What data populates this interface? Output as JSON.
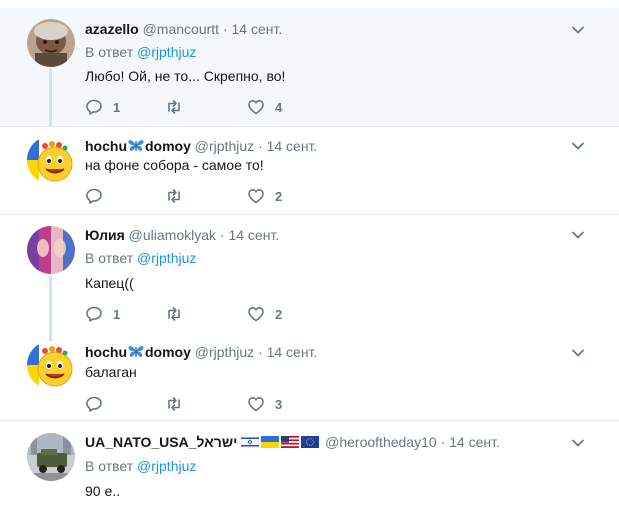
{
  "tweets": [
    {
      "name": "azazello",
      "handle": "@mancourtt",
      "dot": "·",
      "time": "14 сент.",
      "reply_prefix": "В ответ",
      "reply_to": "@rjpthjuz",
      "text": "Любо! Ой, не то... Скрепно, во!",
      "replies": "1",
      "retweets": "",
      "likes": "4"
    },
    {
      "name_part1": "hochu",
      "name_part2": "domoy",
      "handle": "@rjpthjuz",
      "dot": "·",
      "time": "14 сент.",
      "text": "на фоне собора - самое то!",
      "replies": "",
      "retweets": "",
      "likes": "2"
    },
    {
      "name": "Юлия",
      "handle": "@uliamoklyak",
      "dot": "·",
      "time": "14 сент.",
      "reply_prefix": "В ответ",
      "reply_to": "@rjpthjuz",
      "text": "Капец((",
      "replies": "1",
      "retweets": "",
      "likes": "2"
    },
    {
      "name_part1": "hochu",
      "name_part2": "domoy",
      "handle": "@rjpthjuz",
      "dot": "·",
      "time": "14 сент.",
      "text": "балаган",
      "replies": "",
      "retweets": "",
      "likes": "3"
    },
    {
      "name": "UA_NATO_USA_ישראל",
      "handle": "@herooftheday10",
      "dot": "·",
      "time": "14 сент.",
      "reply_prefix": "В ответ",
      "reply_to": "@rjpthjuz",
      "text": "90 е.."
    }
  ],
  "icons": {
    "caret": "chevron-down-icon",
    "reply": "reply-icon",
    "retweet": "retweet-icon",
    "like": "heart-icon",
    "butterfly": "butterfly-icon"
  },
  "colors": {
    "accent": "#1b95e0",
    "muted": "#657786",
    "highlight_bg": "#f5f8fa",
    "thread_line": "#cfe2f2"
  }
}
